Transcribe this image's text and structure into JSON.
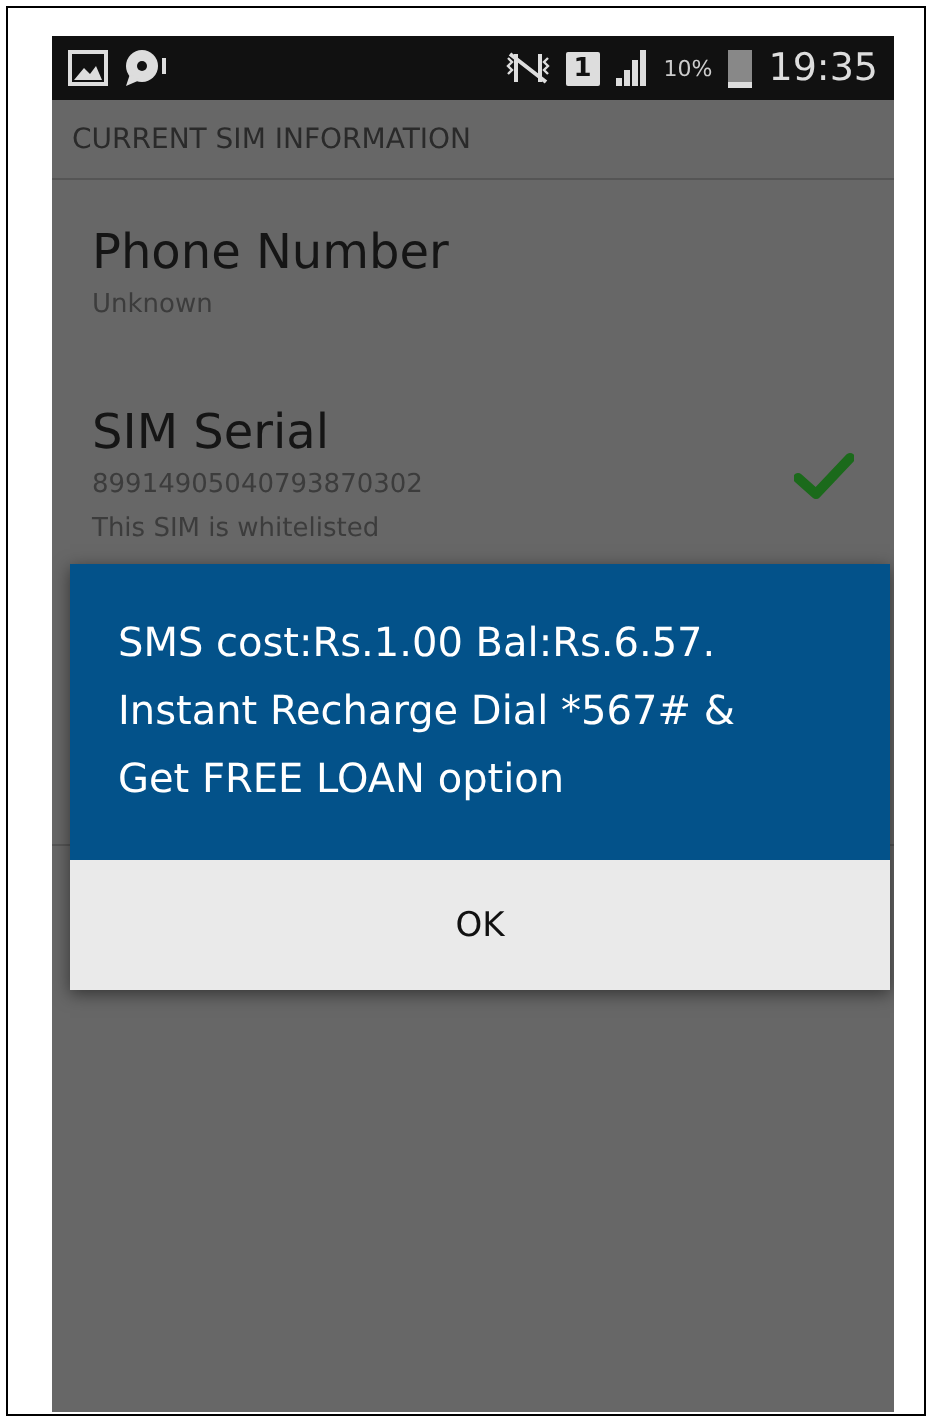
{
  "status_bar": {
    "sim_slot": "1",
    "battery": "10%",
    "time": "19:35"
  },
  "header": {
    "title": "CURRENT SIM INFORMATION"
  },
  "items": [
    {
      "title": "Phone Number",
      "lines": [
        "Unknown"
      ],
      "verified": false
    },
    {
      "title": "SIM Serial",
      "lines": [
        "89914905040793870302",
        "This SIM is whitelisted"
      ],
      "verified": true
    }
  ],
  "dialog": {
    "message": "SMS cost:Rs.1.00 Bal:Rs.6.57. Instant Recharge Dial *567# & Get FREE LOAN option",
    "button": "OK"
  }
}
